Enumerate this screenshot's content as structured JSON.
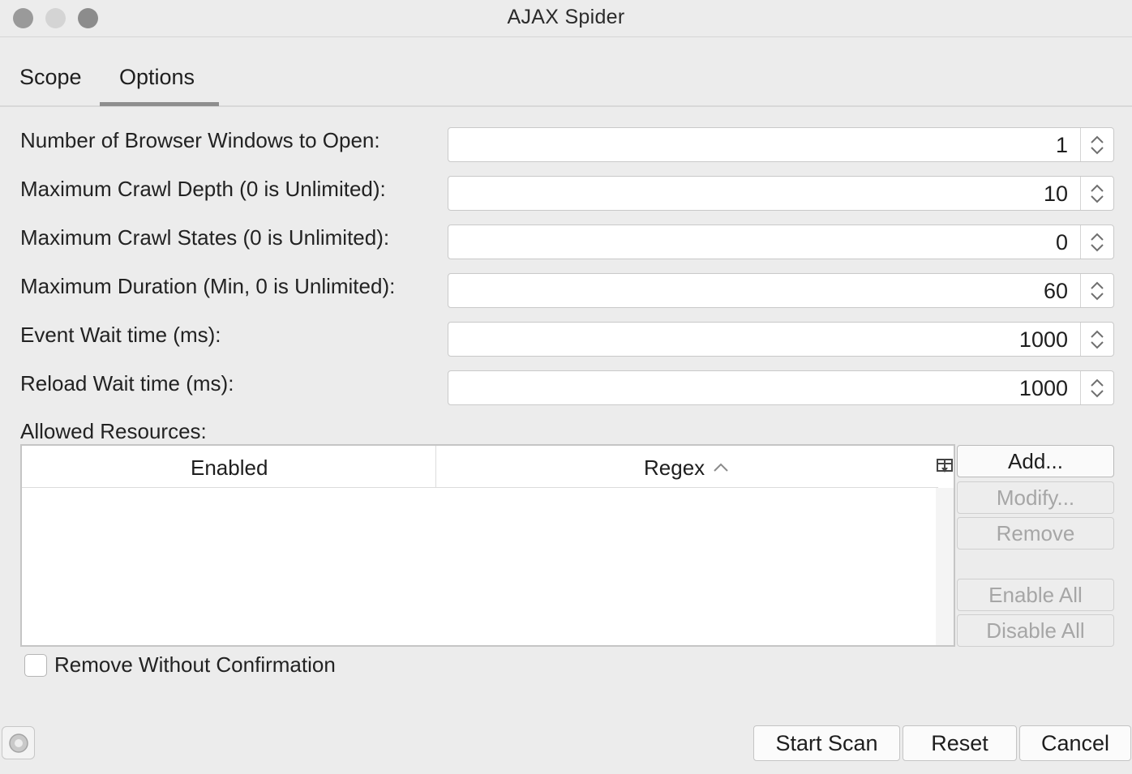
{
  "window": {
    "title": "AJAX Spider"
  },
  "tabs": [
    {
      "label": "Scope",
      "active": false
    },
    {
      "label": "Options",
      "active": true
    }
  ],
  "options": {
    "browser_windows": {
      "label": "Number of Browser Windows to Open:",
      "value": "1"
    },
    "crawl_depth": {
      "label": "Maximum Crawl Depth (0 is Unlimited):",
      "value": "10"
    },
    "crawl_states": {
      "label": "Maximum Crawl States (0 is Unlimited):",
      "value": "0"
    },
    "duration": {
      "label": "Maximum Duration (Min, 0 is Unlimited):",
      "value": "60"
    },
    "event_wait": {
      "label": "Event Wait time (ms):",
      "value": "1000"
    },
    "reload_wait": {
      "label": "Reload Wait time (ms):",
      "value": "1000"
    }
  },
  "allowed_resources": {
    "label": "Allowed Resources:",
    "columns": [
      "Enabled",
      "Regex"
    ],
    "sort_column": "Regex",
    "sort_direction": "ascending",
    "rows": [],
    "buttons": {
      "add": "Add...",
      "modify": "Modify...",
      "remove": "Remove",
      "enable_all": "Enable All",
      "disable_all": "Disable All"
    },
    "remove_without_confirmation": {
      "label": "Remove Without Confirmation",
      "checked": false
    }
  },
  "footer": {
    "start_scan": "Start Scan",
    "reset": "Reset",
    "cancel": "Cancel"
  }
}
